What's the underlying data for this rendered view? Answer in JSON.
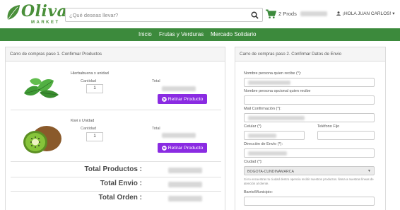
{
  "header": {
    "logo_text": "Oliva",
    "logo_sub": "MARKET",
    "search_placeholder": "¿Qué deseas llevar?",
    "cart_label": "2 Prods",
    "user_label": "¡HOLA JUAN CARLOS!",
    "user_caret": "▾"
  },
  "nav": {
    "items": [
      "Inicio",
      "Frutas y Verduras",
      "Mercado Solidario"
    ]
  },
  "cart_panel": {
    "title": "Carro de compras paso 1. Confirmar Productos",
    "products": [
      {
        "name": "Hierbabuena x unidad",
        "quantity_label": "Cantidad",
        "quantity": "1",
        "total_label": "Total",
        "remove_label": "Retirar Producto"
      },
      {
        "name": "Kiwi x Unidad",
        "quantity_label": "Cantidad",
        "quantity": "1",
        "total_label": "Total",
        "remove_label": "Retirar Producto"
      }
    ],
    "summary": {
      "products_label": "Total Productos :",
      "shipping_label": "Total Envio :",
      "order_label": "Total Orden :"
    }
  },
  "delivery_panel": {
    "title": "Carro de compras paso 2. Confirmar Datos de Envio",
    "fields": {
      "receiver_name": "Nombre persona quien recibe (*):",
      "optional_name": "Nombre persona opcional quien recibe",
      "mail": "Mail Confirmación (*):",
      "mobile": "Celular (*)",
      "phone": "Teléfono Fijo",
      "address": "Dirección de Envío (*):",
      "city": "Ciudad (*):",
      "city_value": "BOGOTA-CUNDINAMARCA",
      "note": "Si no encuentras tu ciudad dentro opencia recibir nuestros productos. llama a nuestras líneas de atención al cliente.",
      "district": "Barrio/Municipio:"
    }
  },
  "colors": {
    "brand_green": "#3c8a3c",
    "remove_button": "#8a2be2"
  }
}
